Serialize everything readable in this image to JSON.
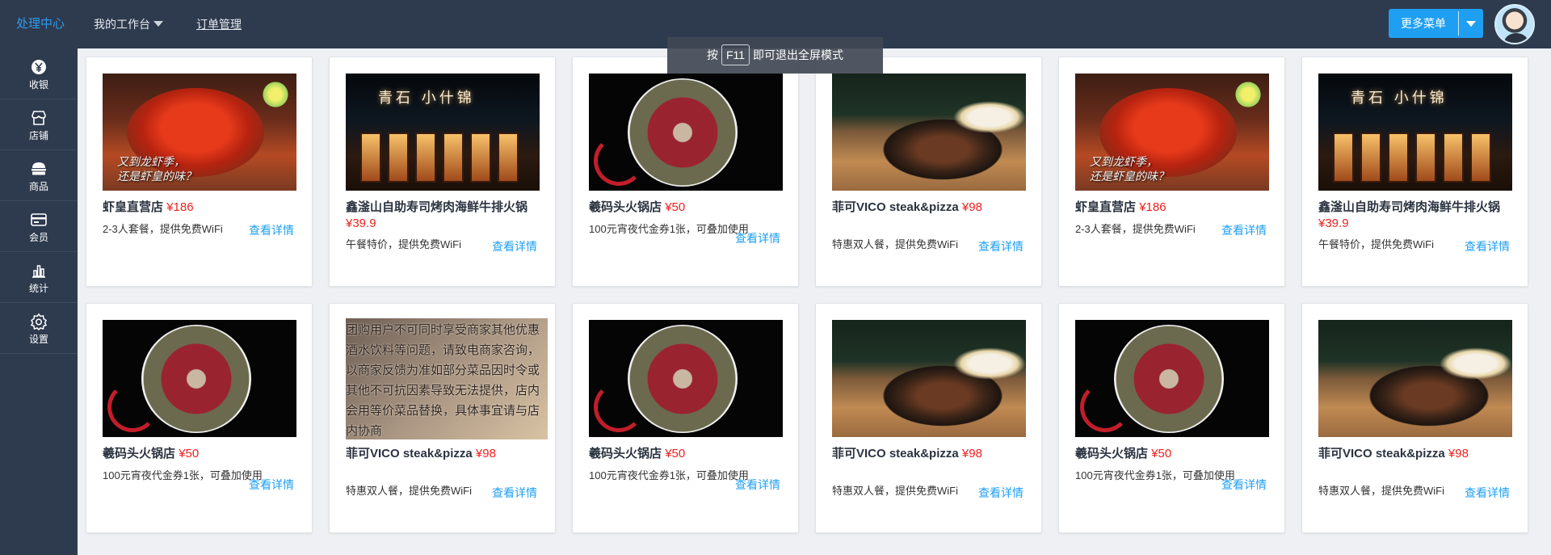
{
  "topbar": {
    "brand": "处理中心",
    "nav": [
      {
        "label": "我的工作台"
      },
      {
        "label": "订单管理"
      }
    ],
    "more_button": "更多菜单"
  },
  "sidebar": {
    "items": [
      {
        "label": "收银",
        "icon": "yen-coin-icon"
      },
      {
        "label": "店铺",
        "icon": "store-icon"
      },
      {
        "label": "商品",
        "icon": "goods-icon"
      },
      {
        "label": "会员",
        "icon": "member-card-icon"
      },
      {
        "label": "统计",
        "icon": "bar-chart-icon"
      },
      {
        "label": "设置",
        "icon": "gear-icon"
      }
    ]
  },
  "toast": {
    "prefix": "按",
    "key": "F11",
    "suffix": "即可退出全屏模式"
  },
  "cards": [
    {
      "name": "虾皇直营店",
      "price": "¥186",
      "desc": "2-3人套餐，提供免费WiFi",
      "detail": "查看详情",
      "image": "crayfish",
      "caption": "又到龙虾季，\n还是虾皇的味？"
    },
    {
      "name": "鑫滏山自助寿司烤肉海鲜牛排火锅",
      "price": "¥39.9",
      "desc": "午餐特价，提供免费WiFi",
      "detail": "查看详情",
      "image": "restaurant",
      "caption": "青石 小什锦"
    },
    {
      "name": "羲码头火锅店",
      "price": "¥50",
      "desc": "100元宵夜代金券1张，可叠加使用",
      "detail": "查看详情",
      "image": "hotpot"
    },
    {
      "name": "菲可VICO steak&pizza",
      "price": "¥98",
      "desc": "特惠双人餐，提供免费WiFi",
      "detail": "查看详情",
      "image": "steak"
    },
    {
      "name": "虾皇直营店",
      "price": "¥186",
      "desc": "2-3人套餐，提供免费WiFi",
      "detail": "查看详情",
      "image": "crayfish",
      "caption": "又到龙虾季，\n还是虾皇的味？"
    },
    {
      "name": "鑫滏山自助寿司烤肉海鲜牛排火锅",
      "price": "¥39.9",
      "desc": "午餐特价，提供免费WiFi",
      "detail": "查看详情",
      "image": "restaurant",
      "caption": "青石 小什锦"
    },
    {
      "name": "羲码头火锅店",
      "price": "¥50",
      "desc": "100元宵夜代金券1张，可叠加使用",
      "detail": "查看详情",
      "image": "hotpot"
    },
    {
      "name": "菲可VICO steak&pizza",
      "price": "¥98",
      "desc": "特惠双人餐，提供免费WiFi",
      "detail": "查看详情",
      "image": "notice",
      "caption": "团购用户不可同时享受商家其他优惠酒水饮料等问题，请致电商家咨询，以商家反馈为准如部分菜品因时令或其他不可抗因素导致无法提供，店内会用等价菜品替换，具体事宜请与店内协商"
    },
    {
      "name": "羲码头火锅店",
      "price": "¥50",
      "desc": "100元宵夜代金券1张，可叠加使用",
      "detail": "查看详情",
      "image": "hotpot"
    },
    {
      "name": "菲可VICO steak&pizza",
      "price": "¥98",
      "desc": "特惠双人餐，提供免费WiFi",
      "detail": "查看详情",
      "image": "steak"
    },
    {
      "name": "羲码头火锅店",
      "price": "¥50",
      "desc": "100元宵夜代金券1张，可叠加使用",
      "detail": "查看详情",
      "image": "hotpot"
    },
    {
      "name": "菲可VICO steak&pizza",
      "price": "¥98",
      "desc": "特惠双人餐，提供免费WiFi",
      "detail": "查看详情",
      "image": "steak"
    }
  ],
  "colors": {
    "topbar_bg": "#2e3a4e",
    "accent_blue": "#1e9ff2",
    "price_red": "#ef1f1f",
    "page_bg": "#eef0f4"
  }
}
